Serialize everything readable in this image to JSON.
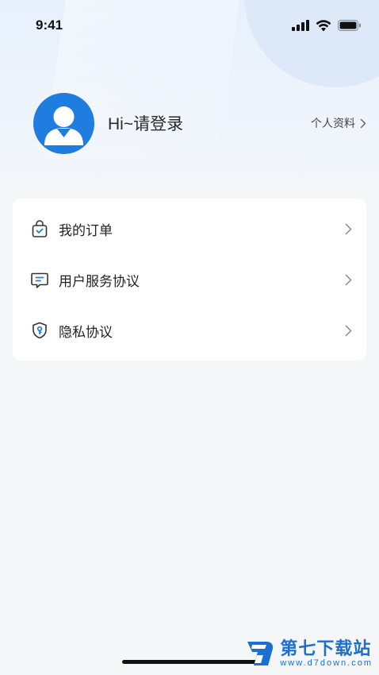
{
  "status_bar": {
    "time": "9:41"
  },
  "profile": {
    "greeting": "Hi~请登录",
    "profile_link_label": "个人资料"
  },
  "menu": {
    "items": [
      {
        "label": "我的订单",
        "icon": "shopping-bag-check-icon"
      },
      {
        "label": "用户服务协议",
        "icon": "message-doc-icon"
      },
      {
        "label": "隐私协议",
        "icon": "shield-key-icon"
      }
    ]
  },
  "watermark": {
    "title": "第七下载站",
    "url": "www.d7down.com"
  },
  "colors": {
    "accent": "#1f7de0",
    "background": "#f5f6f8",
    "header_bg": "#e6f0fc"
  }
}
